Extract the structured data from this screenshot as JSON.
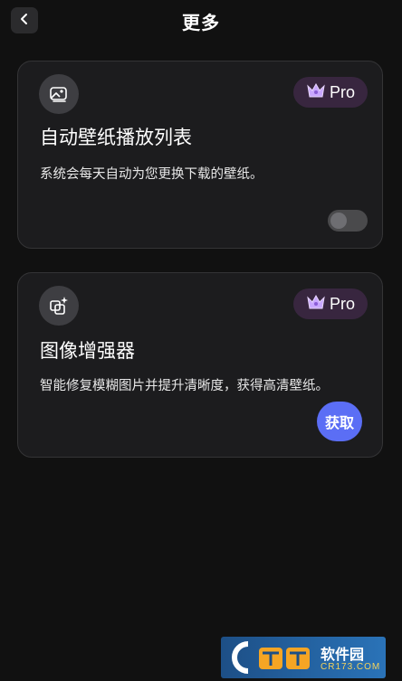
{
  "header": {
    "title": "更多",
    "back_icon": "chevron-left-icon"
  },
  "cards": [
    {
      "icon": "wallpaper-image-icon",
      "badge": "Pro",
      "title": "自动壁纸播放列表",
      "description": "系统会每天自动为您更换下载的壁纸。",
      "toggle_on": false
    },
    {
      "icon": "image-enhancer-icon",
      "badge": "Pro",
      "title": "图像增强器",
      "description": "智能修复模糊图片并提升清晰度，获得高清壁纸。",
      "action_label": "获取"
    }
  ],
  "colors": {
    "background": "#111111",
    "card": "#1c1c1e",
    "pro_badge": "#38263f",
    "crown": "#c9a7ff",
    "accent_button": "#5b6ef5"
  },
  "watermark": {
    "site": "软件园",
    "domain": "CR173.COM"
  }
}
